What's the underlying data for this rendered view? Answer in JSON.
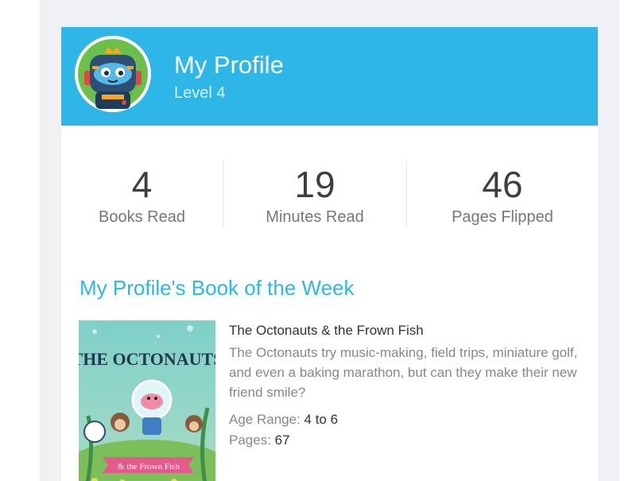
{
  "profile": {
    "name": "My Profile",
    "level": "Level 4"
  },
  "stats": [
    {
      "value": "4",
      "label": "Books Read"
    },
    {
      "value": "19",
      "label": "Minutes Read"
    },
    {
      "value": "46",
      "label": "Pages Flipped"
    }
  ],
  "book_of_week": {
    "heading": "My Profile's Book of the Week",
    "title": "The Octonauts & the Frown Fish",
    "description": "The Octonauts try music-making, field trips, miniature golf, and even a baking marathon, but can they make their new friend smile?",
    "age_label": "Age Range:",
    "age_value": "4 to 6",
    "pages_label": "Pages:",
    "pages_value": "67",
    "cover": {
      "series_text": "THE OCTONAUTS",
      "subtitle_text": "& the Frown Fish"
    }
  },
  "colors": {
    "header": "#2eb7e6",
    "accent": "#2eb7e6",
    "page_bg": "#eef0f3"
  },
  "icons": {
    "avatar": "robot-avatar"
  }
}
